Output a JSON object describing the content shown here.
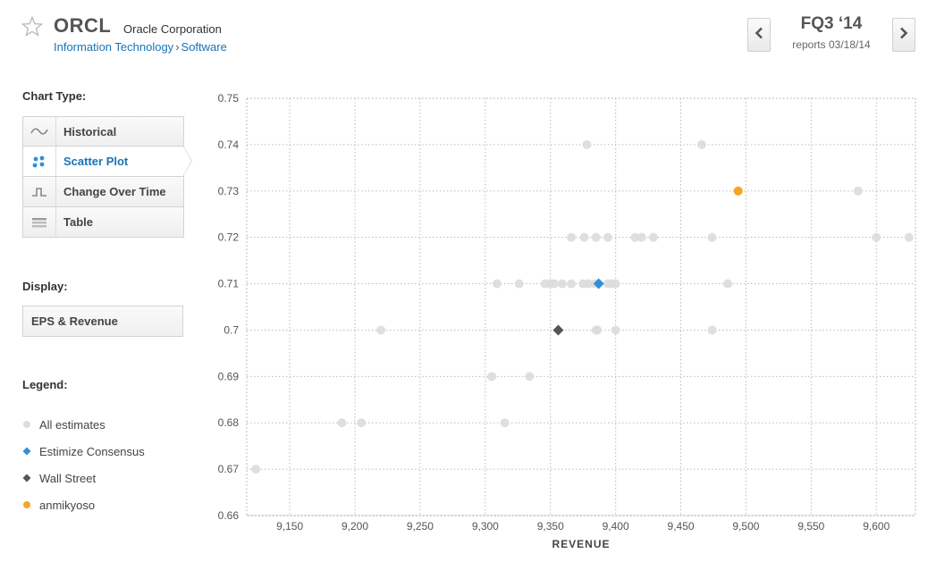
{
  "header": {
    "ticker": "ORCL",
    "company": "Oracle Corporation",
    "sector": "Information Technology",
    "breadcrumb_sep": "›",
    "industry": "Software",
    "quarter": "FQ3 ‘14",
    "reports": "reports 03/18/14"
  },
  "sidebar": {
    "chart_type_label": "Chart Type:",
    "chart_types": [
      {
        "label": "Historical",
        "icon": "wave-icon"
      },
      {
        "label": "Scatter Plot",
        "icon": "scatter-icon"
      },
      {
        "label": "Change Over Time",
        "icon": "step-icon"
      },
      {
        "label": "Table",
        "icon": "table-icon"
      }
    ],
    "active_chart_type": 1,
    "display_label": "Display:",
    "display_value": "EPS & Revenue",
    "legend_label": "Legend:",
    "legend": [
      {
        "label": "All estimates",
        "marker": "circle",
        "color": "#dcdcdc"
      },
      {
        "label": "Estimize Consensus",
        "marker": "diamond",
        "color": "#2f8fd8"
      },
      {
        "label": "Wall Street",
        "marker": "diamond",
        "color": "#555555"
      },
      {
        "label": "anmikyoso",
        "marker": "circle",
        "color": "#f5a623"
      }
    ]
  },
  "chart_data": {
    "type": "scatter",
    "xlabel": "REVENUE",
    "ylabel": "",
    "xlim": [
      9117,
      9630
    ],
    "ylim": [
      0.66,
      0.75
    ],
    "x_ticks": [
      9150,
      9200,
      9250,
      9300,
      9350,
      9400,
      9450,
      9500,
      9550,
      9600
    ],
    "x_tick_labels": [
      "9,150",
      "9,200",
      "9,250",
      "9,300",
      "9,350",
      "9,400",
      "9,450",
      "9,500",
      "9,550",
      "9,600"
    ],
    "y_ticks": [
      0.66,
      0.67,
      0.68,
      0.69,
      0.7,
      0.71,
      0.72,
      0.73,
      0.74,
      0.75
    ],
    "y_tick_labels": [
      "0.66",
      "0.67",
      "0.68",
      "0.69",
      "0.7",
      "0.71",
      "0.72",
      "0.73",
      "0.74",
      "0.75"
    ],
    "grid": true,
    "colors": {
      "estimates": "#dcdcdc",
      "consensus": "#2f8fd8",
      "wall_street": "#555555",
      "user": "#f5a623"
    },
    "series": [
      {
        "name": "All estimates",
        "points": [
          [
            9378,
            0.74
          ],
          [
            9466,
            0.74
          ],
          [
            9586,
            0.73
          ],
          [
            9366,
            0.72
          ],
          [
            9376,
            0.72
          ],
          [
            9385,
            0.72
          ],
          [
            9394,
            0.72
          ],
          [
            9415,
            0.72
          ],
          [
            9420,
            0.72
          ],
          [
            9429,
            0.72
          ],
          [
            9474,
            0.72
          ],
          [
            9600,
            0.72
          ],
          [
            9625,
            0.72
          ],
          [
            9309,
            0.71
          ],
          [
            9326,
            0.71
          ],
          [
            9346,
            0.71
          ],
          [
            9350,
            0.71
          ],
          [
            9353,
            0.71
          ],
          [
            9359,
            0.71
          ],
          [
            9366,
            0.71
          ],
          [
            9375,
            0.71
          ],
          [
            9379,
            0.71
          ],
          [
            9384,
            0.71
          ],
          [
            9394,
            0.71
          ],
          [
            9397,
            0.71
          ],
          [
            9400,
            0.71
          ],
          [
            9486,
            0.71
          ],
          [
            9220,
            0.7
          ],
          [
            9385,
            0.7
          ],
          [
            9386,
            0.7
          ],
          [
            9400,
            0.7
          ],
          [
            9474,
            0.7
          ],
          [
            9305,
            0.69
          ],
          [
            9334,
            0.69
          ],
          [
            9190,
            0.68
          ],
          [
            9205,
            0.68
          ],
          [
            9315,
            0.68
          ],
          [
            9124,
            0.67
          ]
        ]
      },
      {
        "name": "Estimize Consensus",
        "points": [
          [
            9387,
            0.71
          ]
        ]
      },
      {
        "name": "Wall Street",
        "points": [
          [
            9356,
            0.7
          ]
        ]
      },
      {
        "name": "anmikyoso",
        "points": [
          [
            9494,
            0.73
          ]
        ]
      }
    ]
  }
}
